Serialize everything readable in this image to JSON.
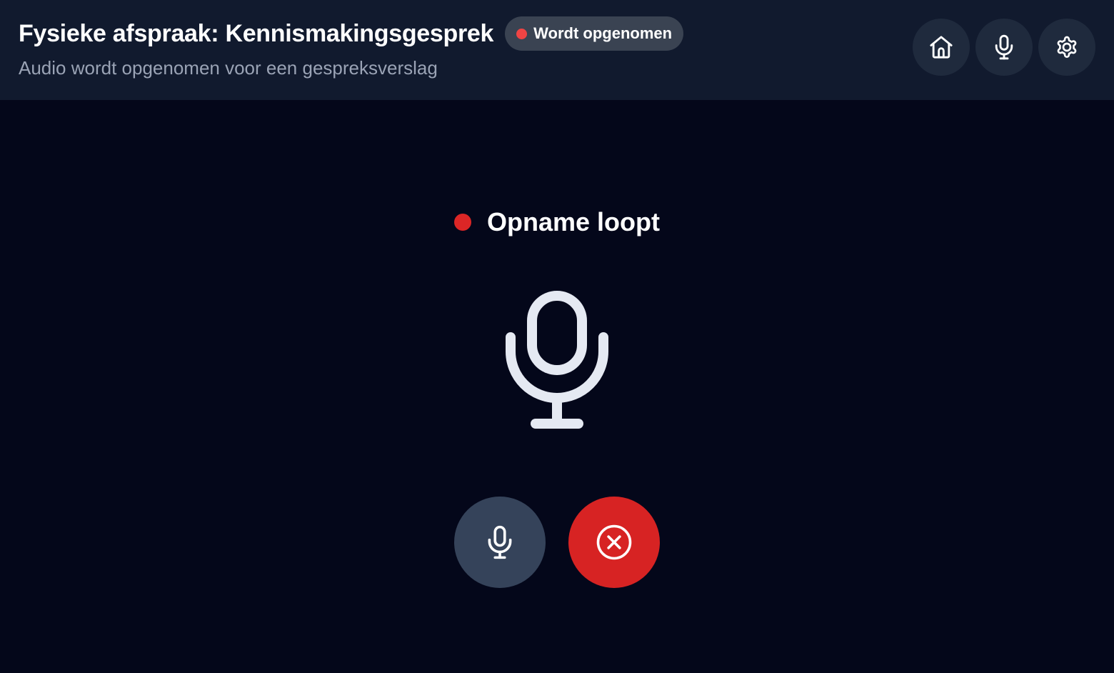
{
  "header": {
    "title": "Fysieke afspraak: Kennismakingsgesprek",
    "badge": {
      "label": "Wordt opgenomen",
      "dot_color": "#ef4444"
    },
    "subtitle": "Audio wordt opgenomen voor een gespreksverslag",
    "buttons": [
      {
        "icon": "home-icon"
      },
      {
        "icon": "microphone-icon"
      },
      {
        "icon": "gear-icon"
      }
    ]
  },
  "main": {
    "status": {
      "label": "Opname loopt",
      "dot_color": "#dc2626"
    },
    "center_icon": "microphone-icon",
    "controls": [
      {
        "icon": "microphone-icon",
        "color": "#35435a"
      },
      {
        "icon": "close-circle-icon",
        "color": "#d72323"
      }
    ]
  },
  "colors": {
    "background": "#04071a",
    "header_background": "#111a2e",
    "header_button": "#1f2a3d",
    "badge_background": "#3a4352",
    "subtitle": "#9aa3b5",
    "icon_light": "#e5e9f2"
  }
}
